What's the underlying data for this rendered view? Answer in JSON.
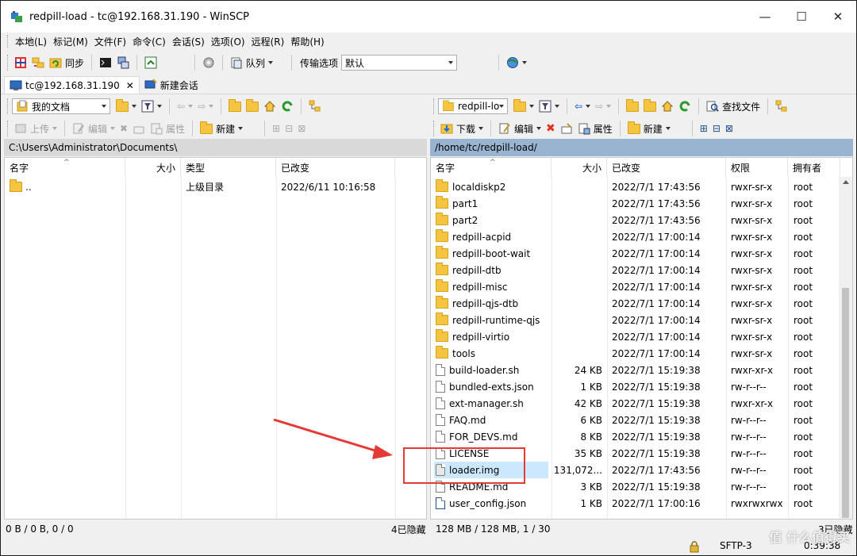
{
  "window": {
    "title": "redpill-load - tc@192.168.31.190 - WinSCP",
    "minimize": "—",
    "maximize": "☐",
    "close": "✕"
  },
  "menu": [
    "本地(L)",
    "标记(M)",
    "文件(F)",
    "命令(C)",
    "会话(S)",
    "选项(O)",
    "远程(R)",
    "帮助(H)"
  ],
  "toolbar": {
    "sync": "同步",
    "queue": "队列",
    "transfer_label": "传输选项",
    "transfer_value": "默认"
  },
  "tabs": [
    {
      "label": "tc@192.168.31.190",
      "close": "✕"
    },
    {
      "label": "新建会话"
    }
  ],
  "left": {
    "location": "我的文档",
    "actions": {
      "upload": "上传",
      "edit": "编辑",
      "properties": "属性",
      "new": "新建"
    },
    "path": "C:\\Users\\Administrator\\Documents\\",
    "columns": [
      "名字",
      "大小",
      "类型",
      "已改变"
    ],
    "rows": [
      {
        "name": "..",
        "size": "",
        "type": "上级目录",
        "changed": "2022/6/11   10:16:58"
      }
    ]
  },
  "right": {
    "location": "redpill-lo",
    "find": "查找文件",
    "actions": {
      "download": "下载",
      "edit": "编辑",
      "properties": "属性",
      "new": "新建"
    },
    "path": "/home/tc/redpill-load/",
    "columns": [
      "名字",
      "大小",
      "已改变",
      "权限",
      "拥有者"
    ],
    "rows": [
      {
        "name": "localdiskp2",
        "kind": "folder",
        "size": "",
        "changed": "2022/7/1 17:43:56",
        "rights": "rwxr-sr-x",
        "owner": "root"
      },
      {
        "name": "part1",
        "kind": "folder",
        "size": "",
        "changed": "2022/7/1 17:43:56",
        "rights": "rwxr-sr-x",
        "owner": "root"
      },
      {
        "name": "part2",
        "kind": "folder",
        "size": "",
        "changed": "2022/7/1 17:43:56",
        "rights": "rwxr-sr-x",
        "owner": "root"
      },
      {
        "name": "redpill-acpid",
        "kind": "folder",
        "size": "",
        "changed": "2022/7/1 17:00:14",
        "rights": "rwxr-sr-x",
        "owner": "root"
      },
      {
        "name": "redpill-boot-wait",
        "kind": "folder",
        "size": "",
        "changed": "2022/7/1 17:00:14",
        "rights": "rwxr-sr-x",
        "owner": "root"
      },
      {
        "name": "redpill-dtb",
        "kind": "folder",
        "size": "",
        "changed": "2022/7/1 17:00:14",
        "rights": "rwxr-sr-x",
        "owner": "root"
      },
      {
        "name": "redpill-misc",
        "kind": "folder",
        "size": "",
        "changed": "2022/7/1 17:00:14",
        "rights": "rwxr-sr-x",
        "owner": "root"
      },
      {
        "name": "redpill-qjs-dtb",
        "kind": "folder",
        "size": "",
        "changed": "2022/7/1 17:00:14",
        "rights": "rwxr-sr-x",
        "owner": "root"
      },
      {
        "name": "redpill-runtime-qjs",
        "kind": "folder",
        "size": "",
        "changed": "2022/7/1 17:00:14",
        "rights": "rwxr-sr-x",
        "owner": "root"
      },
      {
        "name": "redpill-virtio",
        "kind": "folder",
        "size": "",
        "changed": "2022/7/1 17:00:14",
        "rights": "rwxr-sr-x",
        "owner": "root"
      },
      {
        "name": "tools",
        "kind": "folder",
        "size": "",
        "changed": "2022/7/1 17:00:14",
        "rights": "rwxr-sr-x",
        "owner": "root"
      },
      {
        "name": "build-loader.sh",
        "kind": "file",
        "size": "24 KB",
        "changed": "2022/7/1 15:19:38",
        "rights": "rwxr-xr-x",
        "owner": "root"
      },
      {
        "name": "bundled-exts.json",
        "kind": "file",
        "size": "1 KB",
        "changed": "2022/7/1 15:19:38",
        "rights": "rw-r--r--",
        "owner": "root"
      },
      {
        "name": "ext-manager.sh",
        "kind": "file",
        "size": "42 KB",
        "changed": "2022/7/1 15:19:38",
        "rights": "rwxr-xr-x",
        "owner": "root"
      },
      {
        "name": "FAQ.md",
        "kind": "file",
        "size": "6 KB",
        "changed": "2022/7/1 15:19:38",
        "rights": "rw-r--r--",
        "owner": "root"
      },
      {
        "name": "FOR_DEVS.md",
        "kind": "file",
        "size": "8 KB",
        "changed": "2022/7/1 15:19:38",
        "rights": "rw-r--r--",
        "owner": "root"
      },
      {
        "name": "LICENSE",
        "kind": "file",
        "size": "35 KB",
        "changed": "2022/7/1 15:19:38",
        "rights": "rw-r--r--",
        "owner": "root"
      },
      {
        "name": "loader.img",
        "kind": "image",
        "size": "131,072...",
        "changed": "2022/7/1 17:43:56",
        "rights": "rw-r--r--",
        "owner": "root",
        "selected": true
      },
      {
        "name": "README.md",
        "kind": "file",
        "size": "3 KB",
        "changed": "2022/7/1 15:19:38",
        "rights": "rw-r--r--",
        "owner": "root"
      },
      {
        "name": "user_config.json",
        "kind": "json",
        "size": "1 KB",
        "changed": "2022/7/1 17:00:16",
        "rights": "rwxrwxrwx",
        "owner": "root"
      }
    ]
  },
  "status": {
    "left": "0 B / 0 B,   0 / 0",
    "left_hidden": "4已隐藏",
    "right": "128 MB / 128 MB,   1 / 30",
    "right_hidden": "3已隐藏",
    "protocol": "SFTP-3",
    "time": "0:39:38"
  },
  "watermark": "值 什么值得买"
}
